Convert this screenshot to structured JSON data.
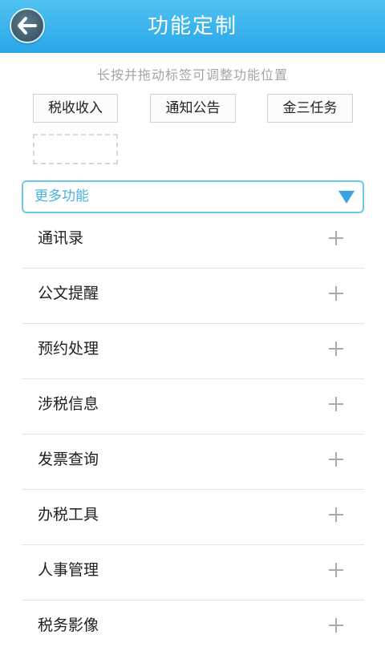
{
  "header": {
    "title": "功能定制",
    "back_icon": "back-arrow-icon",
    "background_color": "#38b3ee"
  },
  "hint": "长按并拖动标签可调整功能位置",
  "tags": [
    {
      "label": "税收收入"
    },
    {
      "label": "通知公告"
    },
    {
      "label": "金三任务"
    }
  ],
  "more": {
    "label": "更多功能",
    "icon": "dropdown-triangle-icon",
    "accent_color": "#3aa6e0"
  },
  "functions": [
    {
      "label": "通讯录",
      "icon": "plus-icon"
    },
    {
      "label": "公文提醒",
      "icon": "plus-icon"
    },
    {
      "label": "预约处理",
      "icon": "plus-icon"
    },
    {
      "label": "涉税信息",
      "icon": "plus-icon"
    },
    {
      "label": "发票查询",
      "icon": "plus-icon"
    },
    {
      "label": "办税工具",
      "icon": "plus-icon"
    },
    {
      "label": "人事管理",
      "icon": "plus-icon"
    },
    {
      "label": "税务影像",
      "icon": "plus-icon"
    }
  ]
}
